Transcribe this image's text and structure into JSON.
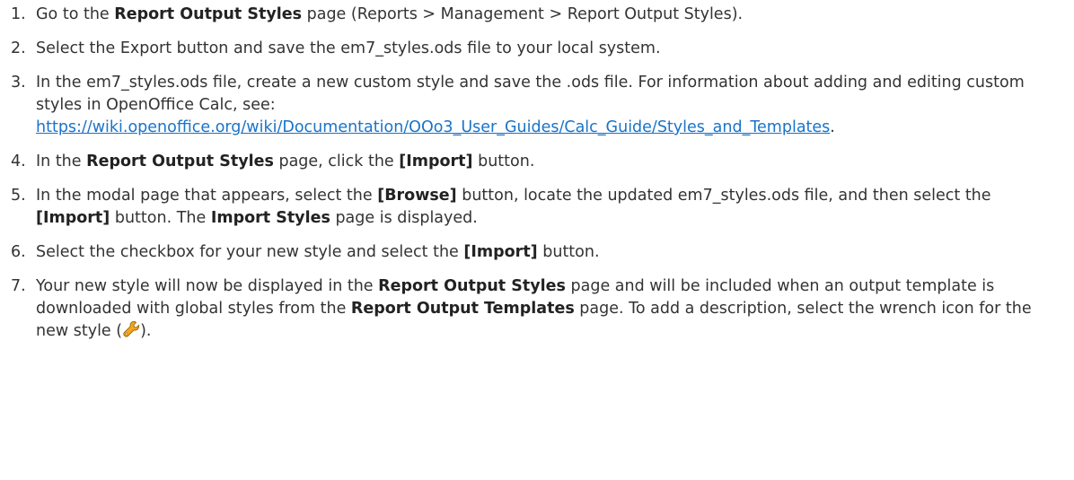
{
  "steps": [
    {
      "number": "1.",
      "parts": [
        {
          "t": "Go to the "
        },
        {
          "t": "Report Output Styles",
          "b": true
        },
        {
          "t": " page (Reports > Management > Report Output Styles)."
        }
      ]
    },
    {
      "number": "2.",
      "parts": [
        {
          "t": "Select the Export button and save the em7_styles.ods file to your local system."
        }
      ]
    },
    {
      "number": "3.",
      "parts": [
        {
          "t": "In the em7_styles.ods file, create a new custom style and save the .ods file. For information about adding and editing custom styles in OpenOffice Calc, see:"
        },
        {
          "br": true
        },
        {
          "t": "https://wiki.openoffice.org/wiki/Documentation/OOo3_User_Guides/Calc_Guide/Styles_and_Templates",
          "link": true
        },
        {
          "t": "."
        }
      ]
    },
    {
      "number": "4.",
      "parts": [
        {
          "t": "In the "
        },
        {
          "t": "Report Output Styles",
          "b": true
        },
        {
          "t": " page, click the "
        },
        {
          "t": "[Import]",
          "b": true
        },
        {
          "t": " button."
        }
      ]
    },
    {
      "number": "5.",
      "parts": [
        {
          "t": "In the modal page that appears, select the "
        },
        {
          "t": "[Browse]",
          "b": true
        },
        {
          "t": " button, locate the updated em7_styles.ods file, and then select the "
        },
        {
          "t": "[Import]",
          "b": true
        },
        {
          "t": " button. The "
        },
        {
          "t": "Import Styles",
          "b": true
        },
        {
          "t": " page is displayed."
        }
      ]
    },
    {
      "number": "6.",
      "parts": [
        {
          "t": "Select the checkbox for your new style and select the "
        },
        {
          "t": "[Import]",
          "b": true
        },
        {
          "t": " button."
        }
      ]
    },
    {
      "number": "7.",
      "parts": [
        {
          "t": "Your new style will now be displayed in the "
        },
        {
          "t": "Report Output Styles",
          "b": true
        },
        {
          "t": " page and will be included when an output template is downloaded with global styles from the "
        },
        {
          "t": "Report Output Templates",
          "b": true
        },
        {
          "t": " page. To add a description, select the wrench icon for the new style ("
        },
        {
          "icon": "wrench-icon"
        },
        {
          "t": ")."
        }
      ]
    }
  ],
  "colors": {
    "text": "#333333",
    "link": "#1a73c9",
    "wrench_body": "#f0a81e"
  }
}
